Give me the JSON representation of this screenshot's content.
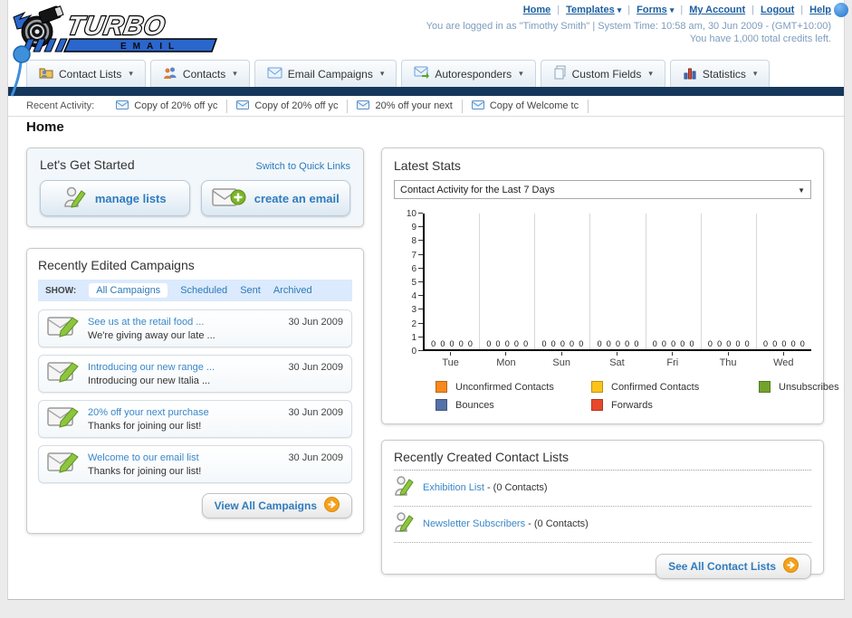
{
  "header": {
    "logo_line1": "TURBO",
    "logo_line2": "EMAIL",
    "nav_links": [
      {
        "label": "Home"
      },
      {
        "label": "Templates"
      },
      {
        "label": "Forms"
      },
      {
        "label": "My Account"
      },
      {
        "label": "Logout"
      },
      {
        "label": "Help"
      }
    ],
    "login_info": "You are logged in as \"Timothy Smith\" | System Time: 10:58 am, 30 Jun 2009 - (GMT+10:00)",
    "credits_info": "You have 1,000 total credits left."
  },
  "nav_tabs": [
    {
      "label": "Contact Lists",
      "icon": "folder-contacts-icon"
    },
    {
      "label": "Contacts",
      "icon": "contacts-icon"
    },
    {
      "label": "Email Campaigns",
      "icon": "envelope-icon"
    },
    {
      "label": "Autoresponders",
      "icon": "envelope-arrow-icon"
    },
    {
      "label": "Custom Fields",
      "icon": "pages-icon"
    },
    {
      "label": "Statistics",
      "icon": "bar-chart-icon"
    }
  ],
  "recent_activity": {
    "label": "Recent Activity:",
    "items": [
      "Copy of 20% off yc",
      "Copy of 20% off yc",
      "20% off your next ",
      "Copy of Welcome tc"
    ]
  },
  "page_title": "Home",
  "get_started": {
    "title": "Let's Get Started",
    "switch_link": "Switch to Quick Links",
    "manage_label": "manage lists",
    "create_label": "create an email"
  },
  "campaigns": {
    "title": "Recently Edited Campaigns",
    "show_label": "SHOW:",
    "filters": [
      "All Campaigns",
      "Scheduled",
      "Sent",
      "Archived"
    ],
    "active_filter": "All Campaigns",
    "items": [
      {
        "title": "See us at the retail food ...",
        "subtitle": "We're giving away our late ...",
        "date": "30 Jun 2009"
      },
      {
        "title": "Introducing our new range ...",
        "subtitle": "Introducing our new Italia ...",
        "date": "30 Jun 2009"
      },
      {
        "title": "20% off your next purchase",
        "subtitle": "Thanks for joining our list!",
        "date": "30 Jun 2009"
      },
      {
        "title": "Welcome to our email list",
        "subtitle": "Thanks for joining our list!",
        "date": "30 Jun 2009"
      }
    ],
    "view_all_label": "View All Campaigns"
  },
  "latest_stats": {
    "title": "Latest Stats",
    "dropdown_value": "Contact Activity for the Last 7 Days"
  },
  "chart_data": {
    "type": "bar",
    "title": "Contact Activity for the Last 7 Days",
    "categories": [
      "Tue",
      "Mon",
      "Sun",
      "Sat",
      "Fri",
      "Thu",
      "Wed"
    ],
    "series": [
      {
        "name": "Unconfirmed Contacts",
        "color": "#F6891F",
        "values": [
          0,
          0,
          0,
          0,
          0,
          0,
          0
        ]
      },
      {
        "name": "Confirmed Contacts",
        "color": "#FCC31B",
        "values": [
          0,
          0,
          0,
          0,
          0,
          0,
          0
        ]
      },
      {
        "name": "Unsubscribes",
        "color": "#73A32B",
        "values": [
          0,
          0,
          0,
          0,
          0,
          0,
          0
        ]
      },
      {
        "name": "Bounces",
        "color": "#5572A7",
        "values": [
          0,
          0,
          0,
          0,
          0,
          0,
          0
        ]
      },
      {
        "name": "Forwards",
        "color": "#E8492B",
        "values": [
          0,
          0,
          0,
          0,
          0,
          0,
          0
        ]
      }
    ],
    "ylim": [
      0,
      10
    ],
    "yticks": [
      0,
      1,
      2,
      3,
      4,
      5,
      6,
      7,
      8,
      9,
      10
    ],
    "grid": true,
    "legend_position": "bottom",
    "value_labels_shown": true
  },
  "contact_lists": {
    "title": "Recently Created Contact Lists",
    "items": [
      {
        "name": "Exhibition List",
        "detail": "- (0 Contacts)"
      },
      {
        "name": "Newsletter Subscribers",
        "detail": "- (0 Contacts)"
      }
    ],
    "see_all_label": "See All Contact Lists"
  }
}
